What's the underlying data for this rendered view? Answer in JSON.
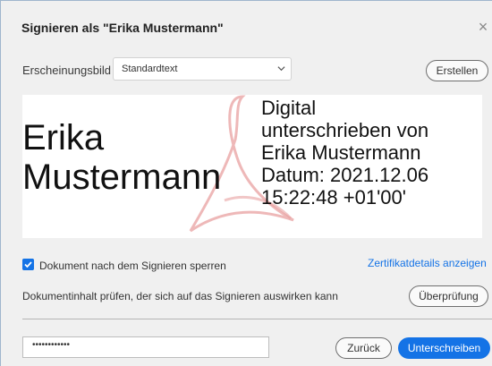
{
  "dialog": {
    "title": "Signieren als \"Erika Mustermann\"",
    "close_glyph": "×"
  },
  "appearance": {
    "label": "Erscheinungsbild",
    "selected": "Standardtext",
    "create_label": "Erstellen"
  },
  "preview": {
    "name_line1": "Erika",
    "name_line2": "Mustermann",
    "details": [
      "Digital",
      "unterschrieben von",
      "Erika Mustermann",
      "Datum: 2021.12.06",
      "15:22:48 +01'00'"
    ]
  },
  "lock": {
    "checked": true,
    "label": "Dokument nach dem Signieren sperren"
  },
  "certificate_link": "Zertifikatdetails anzeigen",
  "verify": {
    "text": "Dokumentinhalt prüfen, der sich auf das Signieren auswirken kann",
    "button": "Überprüfung"
  },
  "password": {
    "value": "••••••••••••"
  },
  "footer": {
    "back_label": "Zurück",
    "sign_label": "Unterschreiben"
  },
  "colors": {
    "accent": "#1473e6",
    "watermark": "#e8a0a0"
  }
}
